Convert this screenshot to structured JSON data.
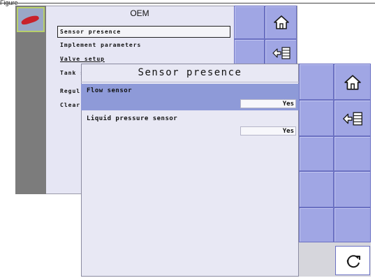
{
  "page": {
    "caption": "Figure"
  },
  "back_screen": {
    "title": "OEM",
    "menu_items": [
      "Sensor presence",
      "Implement parameters",
      "Valve setup",
      "Tank s",
      "Regul",
      "Clear"
    ],
    "selected_index": 0
  },
  "front_dialog": {
    "title": "Sensor presence",
    "settings": [
      {
        "label": "Flow sensor",
        "value": "Yes"
      },
      {
        "label": "Liquid pressure sensor",
        "value": "Yes"
      }
    ]
  },
  "icons": {
    "home": "home-icon",
    "back": "back-list-icon",
    "refresh": "refresh-icon"
  },
  "colors": {
    "tile": "#a0a6e4",
    "selected_row": "#8e9ad8",
    "panel": "#e8e8f4",
    "brand_mark": "#c8222a"
  }
}
